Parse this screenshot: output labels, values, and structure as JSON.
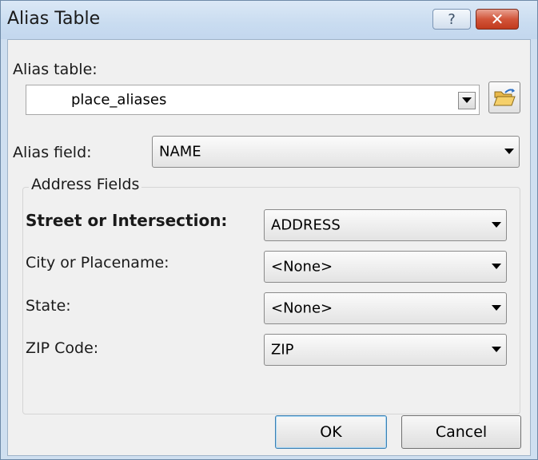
{
  "window": {
    "title": "Alias Table",
    "help_glyph": "?",
    "close_glyph": "✕"
  },
  "alias_table": {
    "label": "Alias table:",
    "value": "place_aliases"
  },
  "alias_field": {
    "label": "Alias field:",
    "value": "NAME"
  },
  "address_fields": {
    "title": "Address Fields",
    "rows": [
      {
        "label": "Street or Intersection:",
        "value": "ADDRESS"
      },
      {
        "label": "City or Placename:",
        "value": "<None>"
      },
      {
        "label": "State:",
        "value": "<None>"
      },
      {
        "label": "ZIP Code:",
        "value": "ZIP"
      }
    ]
  },
  "buttons": {
    "ok": "OK",
    "cancel": "Cancel"
  },
  "icons": [
    "help-icon",
    "close-icon",
    "dropdown-arrow-icon",
    "open-folder-icon"
  ],
  "colors": {
    "titlebar": "#c9dcf0",
    "close_button": "#c8482b",
    "dialog_bg": "#f0f0f0"
  }
}
